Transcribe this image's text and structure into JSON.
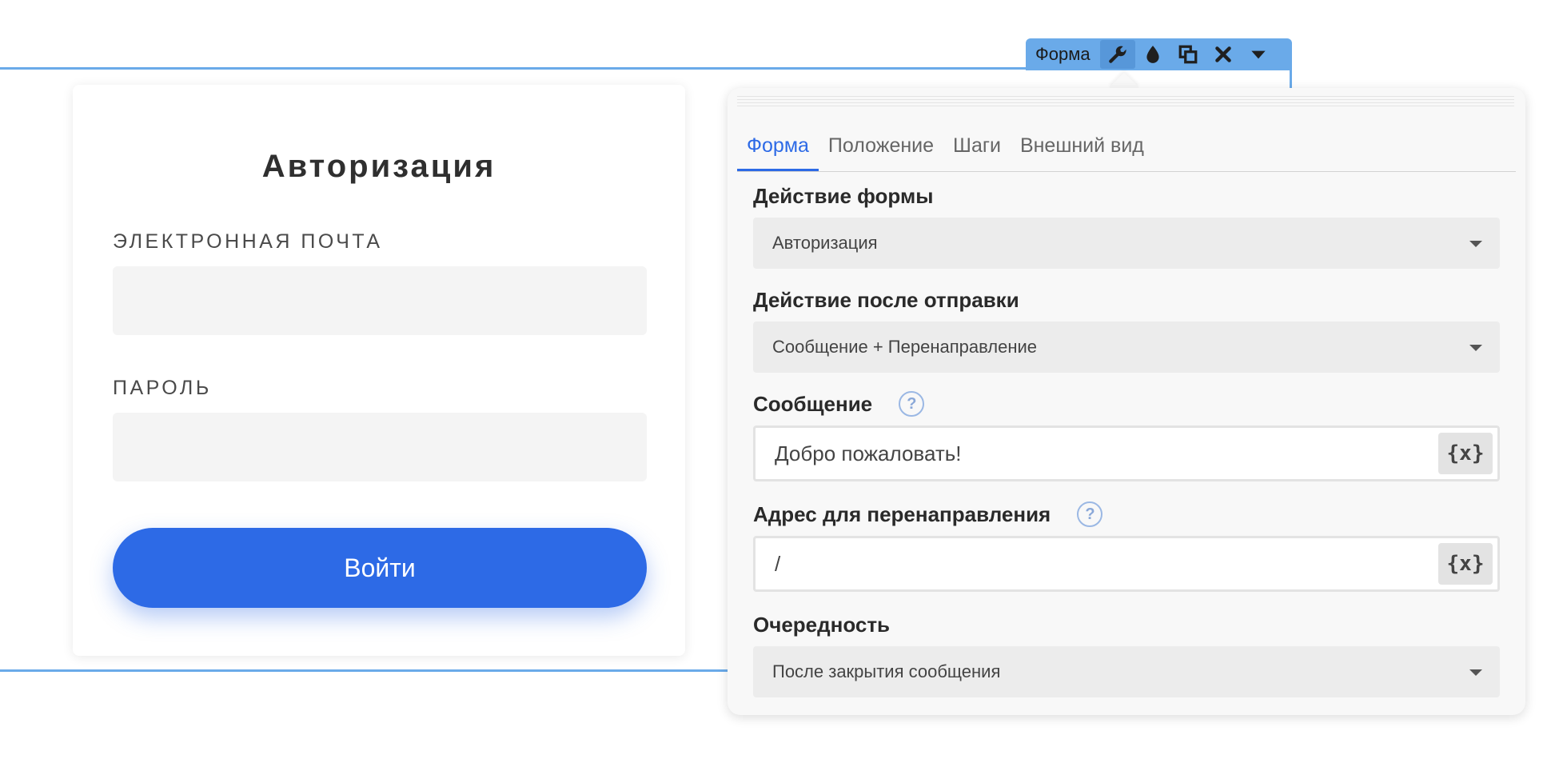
{
  "toolbar": {
    "label": "Форма",
    "icons": [
      "wrench-icon",
      "droplet-icon",
      "copy-icon",
      "close-icon",
      "chevron-down-icon"
    ]
  },
  "login": {
    "title": "Авторизация",
    "email_label": "ЭЛЕКТРОННАЯ ПОЧТА",
    "email_value": "",
    "password_label": "ПАРОЛЬ",
    "password_value": "",
    "submit_label": "Войти"
  },
  "panel": {
    "tabs": [
      {
        "label": "Форма",
        "active": true
      },
      {
        "label": "Положение",
        "active": false
      },
      {
        "label": "Шаги",
        "active": false
      },
      {
        "label": "Внешний вид",
        "active": false
      }
    ],
    "form_action": {
      "label": "Действие формы",
      "value": "Авторизация"
    },
    "after_submit": {
      "label": "Действие после отправки",
      "value": "Сообщение + Перенаправление"
    },
    "message": {
      "label": "Сообщение",
      "help": "?",
      "value": "Добро пожаловать!",
      "var_button": "{x}"
    },
    "redirect": {
      "label": "Адрес для перенаправления",
      "help": "?",
      "value": "/",
      "var_button": "{x}"
    },
    "order": {
      "label": "Очередность",
      "value": "После закрытия сообщения"
    }
  },
  "colors": {
    "accent": "#2d6ae6",
    "selection": "#6aaae9",
    "input_bg": "#f4f4f4",
    "panel_bg": "#f8f8f8"
  }
}
